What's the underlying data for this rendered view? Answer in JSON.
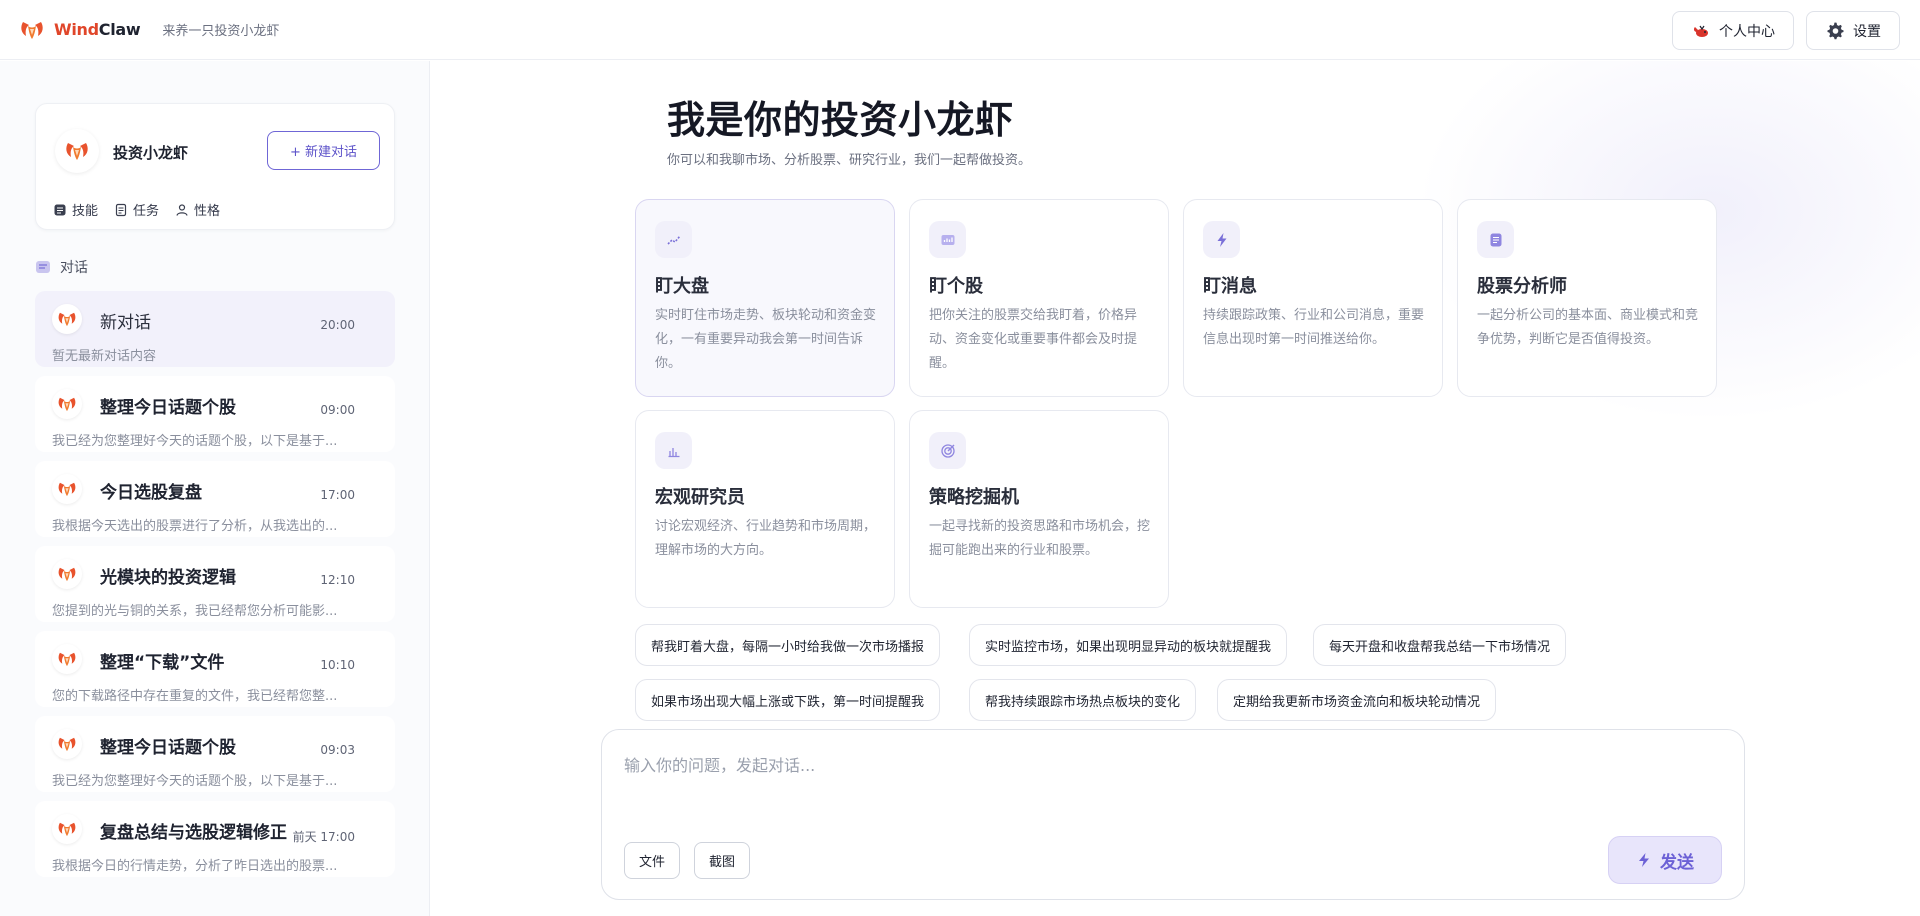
{
  "app": {
    "brand_part1": "Wind",
    "brand_part2": "Claw",
    "tagline": "来养一只投资小龙虾"
  },
  "header_actions": {
    "profile_label": "个人中心",
    "settings_label": "设置"
  },
  "agent": {
    "name": "投资小龙虾",
    "new_chat_label": "+ 新建对话",
    "tabs": [
      {
        "label": "技能",
        "icon": "skill-icon"
      },
      {
        "label": "任务",
        "icon": "task-icon"
      },
      {
        "label": "性格",
        "icon": "personality-icon"
      }
    ]
  },
  "conversations_section": "对话",
  "conversations": [
    {
      "title": "新对话",
      "time": "20:00",
      "preview": "暂无最新对话内容",
      "active": true
    },
    {
      "title": "整理今日话题个股",
      "time": "09:00",
      "preview": "我已经为您整理好今天的话题个股，以下是基于..."
    },
    {
      "title": "今日选股复盘",
      "time": "17:00",
      "preview": "我根据今天选出的股票进行了分析，从我选出的..."
    },
    {
      "title": "光模块的投资逻辑",
      "time": "12:10",
      "preview": "您提到的光与铜的关系，我已经帮您分析可能影..."
    },
    {
      "title": "整理“下载”文件",
      "time": "10:10",
      "preview": "您的下载路径中存在重复的文件，我已经帮您整..."
    },
    {
      "title": "整理今日话题个股",
      "time": "09:03",
      "preview": "我已经为您整理好今天的话题个股，以下是基于..."
    },
    {
      "title": "复盘总结与选股逻辑修正",
      "time": "前天 17:00",
      "preview": "我根据今日的行情走势，分析了昨日选出的股票..."
    }
  ],
  "hero": {
    "title": "我是你的投资小龙虾",
    "subtitle": "你可以和我聊市场、分析股票、研究行业，我们一起帮做投资。"
  },
  "cards": [
    {
      "title": "盯大盘",
      "desc": "实时盯住市场走势、板块轮动和资金变化，一有重要异动我会第一时间告诉你。",
      "icon": "trend-icon",
      "active": true
    },
    {
      "title": "盯个股",
      "desc": "把你关注的股票交给我盯着，价格异动、资金变化或重要事件都会及时提醒。",
      "icon": "bar-chart-icon"
    },
    {
      "title": "盯消息",
      "desc": "持续跟踪政策、行业和公司消息，重要信息出现时第一时间推送给你。",
      "icon": "lightning-icon"
    },
    {
      "title": "股票分析师",
      "desc": "一起分析公司的基本面、商业模式和竞争优势，判断它是否值得投资。",
      "icon": "document-icon"
    },
    {
      "title": "宏观研究员",
      "desc": "讨论宏观经济、行业趋势和市场周期，理解市场的大方向。",
      "icon": "column-chart-icon"
    },
    {
      "title": "策略挖掘机",
      "desc": "一起寻找新的投资思路和市场机会，挖掘可能跑出来的行业和股票。",
      "icon": "target-icon"
    }
  ],
  "suggestions": [
    "帮我盯着大盘，每隔一小时给我做一次市场播报",
    "实时监控市场，如果出现明显异动的板块就提醒我",
    "每天开盘和收盘帮我总结一下市场情况",
    "如果市场出现大幅上涨或下跌，第一时间提醒我",
    "帮我持续跟踪市场热点板块的变化",
    "定期给我更新市场资金流向和板块轮动情况"
  ],
  "composer": {
    "placeholder": "输入你的问题，发起对话...",
    "file_label": "文件",
    "screenshot_label": "截图",
    "send_label": "发送"
  },
  "colors": {
    "accent": "#5c52c9",
    "brand_red": "#e0462a"
  }
}
